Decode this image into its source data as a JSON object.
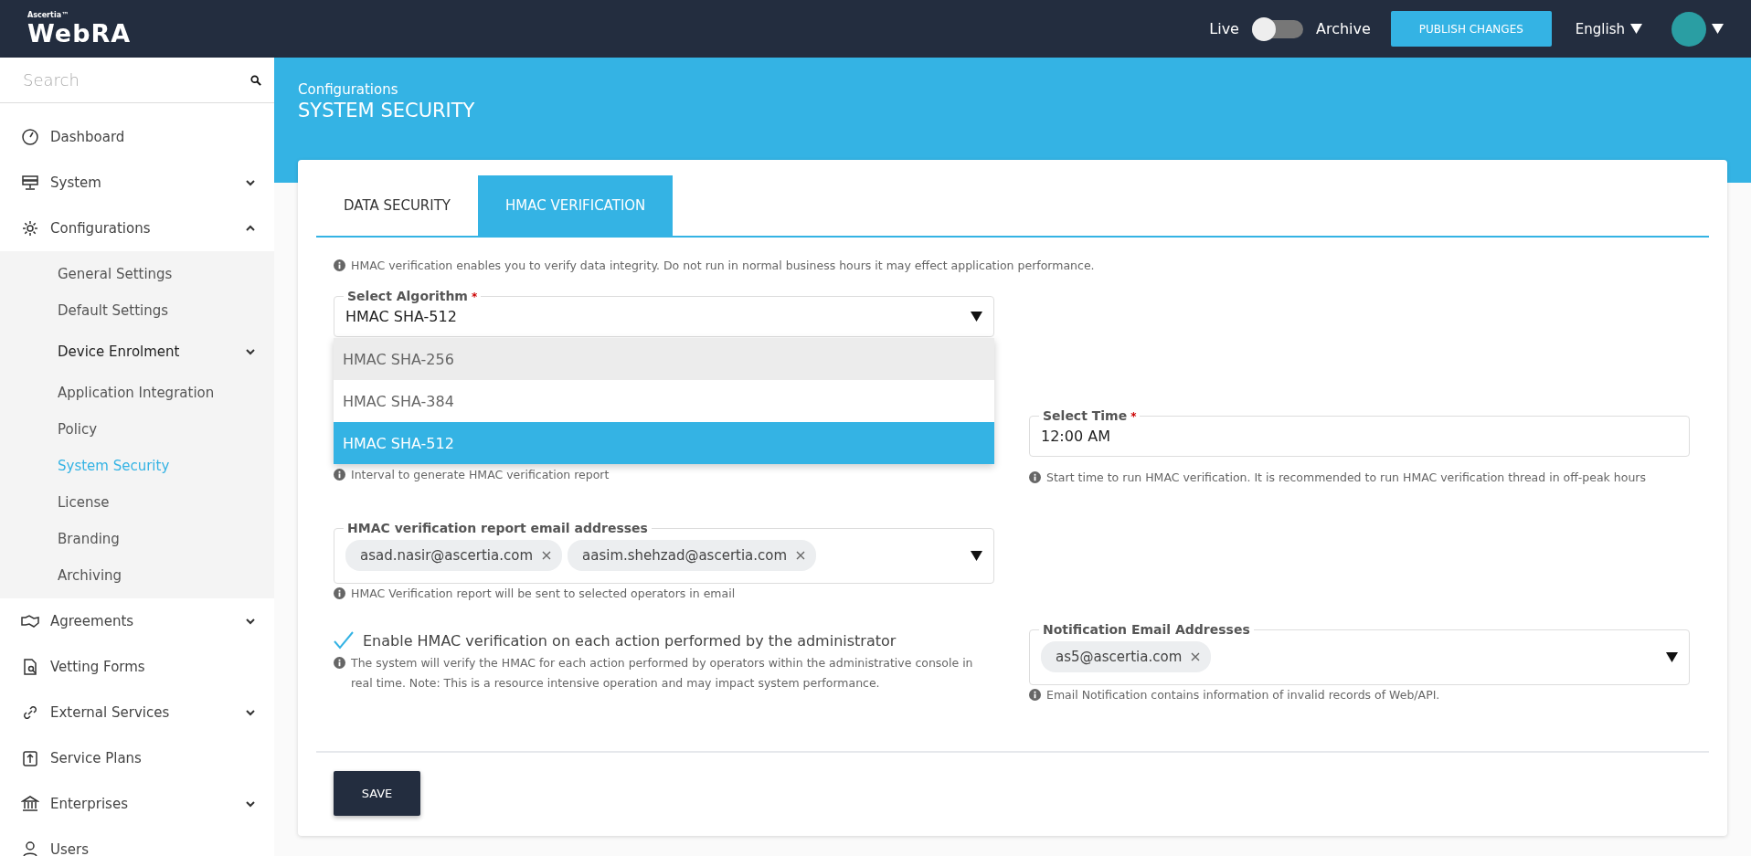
{
  "header": {
    "logo": {
      "brand": "Ascertia™",
      "product": "WebRA"
    },
    "toggle": {
      "left_label": "Live",
      "right_label": "Archive",
      "archive": false
    },
    "publish_button": "PUBLISH CHANGES",
    "language": "English"
  },
  "sidebar": {
    "search": {
      "placeholder": "Search"
    },
    "items": [
      {
        "label": "Dashboard",
        "kind": "link"
      },
      {
        "label": "System",
        "kind": "group",
        "expanded": false
      },
      {
        "label": "Configurations",
        "kind": "group",
        "expanded": true,
        "children": [
          {
            "label": "General Settings",
            "kind": "link",
            "selected": false
          },
          {
            "label": "Default Settings",
            "kind": "link",
            "selected": false
          },
          {
            "label": "Device Enrolment",
            "kind": "group",
            "expanded": false,
            "selected": false
          },
          {
            "label": "Application Integration",
            "kind": "link",
            "selected": false
          },
          {
            "label": "Policy",
            "kind": "link",
            "selected": false
          },
          {
            "label": "System Security",
            "kind": "link",
            "selected": true
          },
          {
            "label": "License",
            "kind": "link",
            "selected": false
          },
          {
            "label": "Branding",
            "kind": "link",
            "selected": false
          },
          {
            "label": "Archiving",
            "kind": "link",
            "selected": false
          }
        ]
      },
      {
        "label": "Agreements",
        "kind": "group",
        "expanded": false
      },
      {
        "label": "Vetting Forms",
        "kind": "link"
      },
      {
        "label": "External Services",
        "kind": "group",
        "expanded": false
      },
      {
        "label": "Service Plans",
        "kind": "link"
      },
      {
        "label": "Enterprises",
        "kind": "group",
        "expanded": false
      },
      {
        "label": "Users",
        "kind": "link"
      }
    ]
  },
  "page": {
    "breadcrumb": "Configurations",
    "title": "SYSTEM SECURITY"
  },
  "tabs": [
    {
      "label": "DATA SECURITY",
      "selected": false
    },
    {
      "label": "HMAC VERIFICATION",
      "selected": true
    }
  ],
  "form": {
    "info": "HMAC verification enables you to verify data integrity. Do not run in normal business hours it may effect application performance.",
    "algorithm": {
      "label": "Select Algorithm",
      "required_mark": "*",
      "value": "HMAC SHA-512",
      "expanded": true,
      "options": [
        {
          "label": "HMAC SHA-256",
          "selected": false,
          "highlighted": true
        },
        {
          "label": "HMAC SHA-384",
          "selected": false,
          "highlighted": false
        },
        {
          "label": "HMAC SHA-512",
          "selected": true,
          "highlighted": false
        }
      ]
    },
    "interval_hint": "Interval to generate HMAC verification report",
    "time": {
      "label": "Select Time",
      "required_mark": "*",
      "value": "12:00 AM",
      "hint": "Start time to run HMAC verification. It is recommended to run HMAC verification thread in off-peak hours"
    },
    "report_emails": {
      "label": "HMAC verification report email addresses",
      "chips": [
        "asad.nasir@ascertia.com",
        "aasim.shehzad@ascertia.com"
      ],
      "hint": "HMAC Verification report will be sent to selected operators in email"
    },
    "enable_check": {
      "label": "Enable HMAC verification on each action performed by the administrator",
      "checked": true,
      "hint": "The system will verify the HMAC for each action performed by operators within the administrative console in real time. Note: This is a resource intensive operation and may impact system performance."
    },
    "notification_emails": {
      "label": "Notification Email Addresses",
      "chips": [
        "as5@ascertia.com"
      ],
      "hint": "Email Notification contains information of invalid records of Web/API."
    },
    "save_button": "SAVE"
  }
}
